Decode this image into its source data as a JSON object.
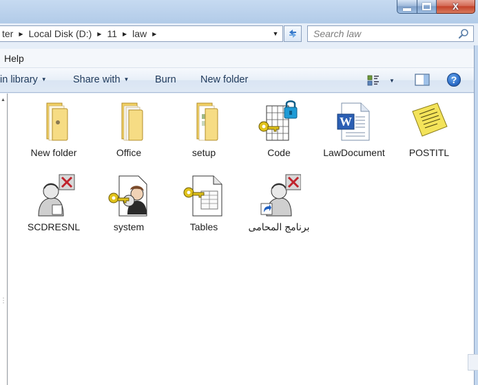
{
  "window": {
    "caption_buttons": [
      "minimize",
      "maximize",
      "close"
    ],
    "close_glyph": "X"
  },
  "address": {
    "crumbs": [
      "ter",
      "Local Disk (D:)",
      "11",
      "law"
    ],
    "separator_icon": "breadcrumb-arrow-icon"
  },
  "search": {
    "placeholder": "Search law",
    "value": ""
  },
  "menu": {
    "items": [
      "Help"
    ]
  },
  "toolbar": {
    "include_in_library_label": "in library",
    "share_with_label": "Share with",
    "burn_label": "Burn",
    "new_folder_label": "New folder",
    "help_glyph": "?"
  },
  "files": [
    {
      "name": "New folder",
      "type": "folder"
    },
    {
      "name": "Office",
      "type": "folder"
    },
    {
      "name": "setup",
      "type": "folder"
    },
    {
      "name": "Code",
      "type": "access-module-locked"
    },
    {
      "name": "LawDocument",
      "type": "word-document"
    },
    {
      "name": "POSTITL",
      "type": "sticky-note"
    },
    {
      "name": "SCDRESNL",
      "type": "access-report"
    },
    {
      "name": "system",
      "type": "access-workgroup"
    },
    {
      "name": "Tables",
      "type": "access-database"
    },
    {
      "name": "برنامج المحامى",
      "type": "access-report-shortcut"
    }
  ],
  "colors": {
    "chrome": "#b9d1ea",
    "command_text": "#1e395b",
    "close_button": "#c4422a",
    "folder": "#f2d36b"
  }
}
